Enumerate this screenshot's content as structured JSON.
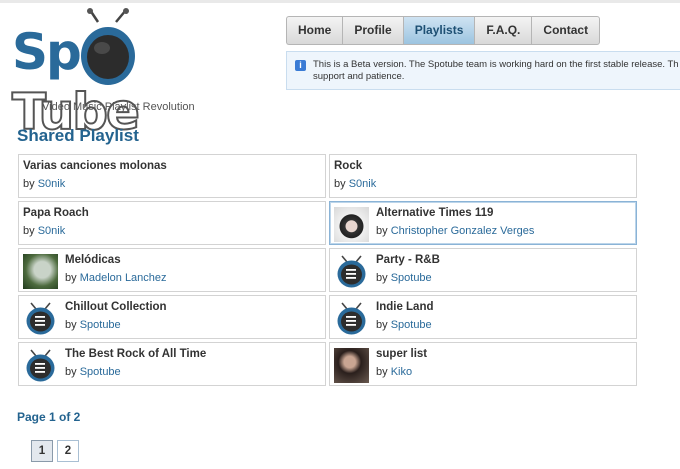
{
  "logo": {
    "part1": "Sp",
    "part2": "Tube",
    "tagline": "Video Music Playlist Revolution"
  },
  "nav": [
    {
      "label": "Home",
      "active": false
    },
    {
      "label": "Profile",
      "active": false
    },
    {
      "label": "Playlists",
      "active": true
    },
    {
      "label": "F.A.Q.",
      "active": false
    },
    {
      "label": "Contact",
      "active": false
    }
  ],
  "notice": {
    "line1": "This is a Beta version. The Spotube team is working hard on the first stable release. Th",
    "line2": "support and patience."
  },
  "section_title": "Shared Playlist",
  "by_prefix": "by",
  "playlists": [
    {
      "title": "Varias canciones molonas",
      "author": "S0nik",
      "thumb": "none"
    },
    {
      "title": "Rock",
      "author": "S0nik",
      "thumb": "none"
    },
    {
      "title": "Papa Roach",
      "author": "S0nik",
      "thumb": "none"
    },
    {
      "title": "Alternative Times 119",
      "author": "Christopher Gonzalez Verges",
      "thumb": "photo-b"
    },
    {
      "title": "Melódicas",
      "author": "Madelon Lanchez",
      "thumb": "photo-a"
    },
    {
      "title": "Party - R&B",
      "author": "Spotube",
      "thumb": "tv"
    },
    {
      "title": "Chillout Collection",
      "author": "Spotube",
      "thumb": "tv"
    },
    {
      "title": "Indie Land",
      "author": "Spotube",
      "thumb": "tv"
    },
    {
      "title": "The Best Rock of All Time",
      "author": "Spotube",
      "thumb": "tv"
    },
    {
      "title": "super list",
      "author": "Kiko",
      "thumb": "photo-c"
    }
  ],
  "pager": {
    "label": "Page 1 of 2",
    "pages": [
      "1",
      "2"
    ],
    "current": "1"
  },
  "colors": {
    "brand": "#2a6a9a",
    "heading": "#23638f",
    "nav_active": "#9cc4e0"
  }
}
